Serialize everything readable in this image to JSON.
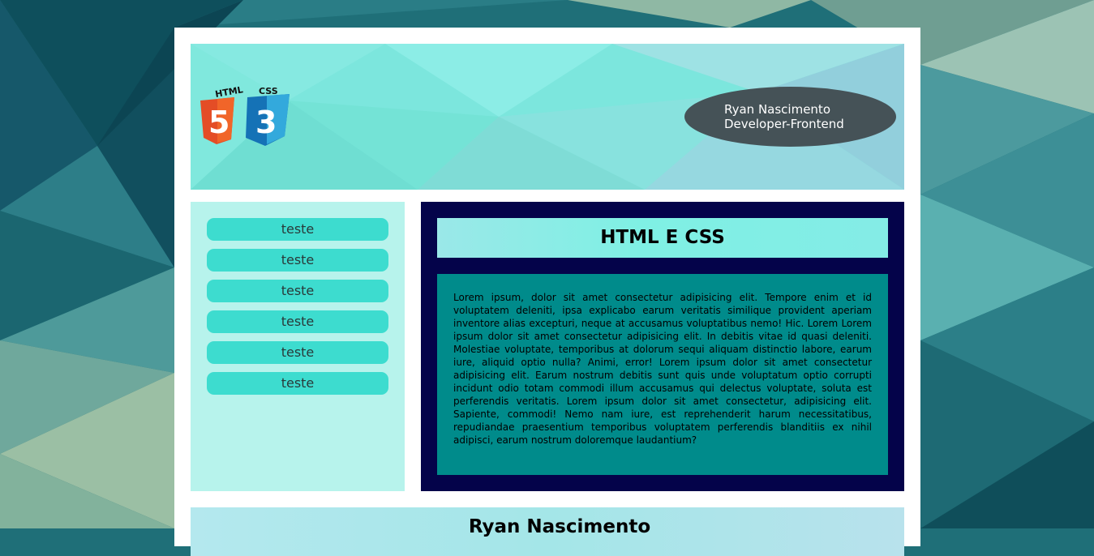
{
  "header": {
    "logo_html_text": "HTML",
    "logo_css_text": "CSS",
    "logo_html_digit": "5",
    "logo_css_digit": "3",
    "author_name": "Ryan Nascimento",
    "author_role": "Developer-Frontend"
  },
  "sidebar": {
    "items": [
      {
        "label": "teste"
      },
      {
        "label": "teste"
      },
      {
        "label": "teste"
      },
      {
        "label": "teste"
      },
      {
        "label": "teste"
      },
      {
        "label": "teste"
      }
    ]
  },
  "main": {
    "title": "HTML E CSS",
    "body": "Lorem ipsum, dolor sit amet consectetur adipisicing elit. Tempore enim et id voluptatem deleniti, ipsa explicabo earum veritatis similique provident aperiam inventore alias excepturi, neque at accusamus voluptatibus nemo! Hic. Lorem Lorem ipsum dolor sit amet consectetur adipisicing elit. In debitis vitae id quasi deleniti. Molestiae voluptate, temporibus at dolorum sequi aliquam distinctio labore, earum iure, aliquid optio nulla? Animi, error! Lorem ipsum dolor sit amet consectetur adipisicing elit. Earum nostrum debitis sunt quis unde voluptatum optio corrupti incidunt odio totam commodi illum accusamus qui delectus voluptate, soluta est perferendis veritatis. Lorem ipsum dolor sit amet consectetur, adipisicing elit. Sapiente, commodi! Nemo nam iure, est reprehenderit harum necessitatibus, repudiandae praesentium temporibus voluptatem perferendis blanditiis ex nihil adipisci, earum nostrum doloremque laudantium?"
  },
  "footer": {
    "title": "Ryan Nascimento"
  },
  "colors": {
    "page_background": "#1f6f78",
    "container": "#ffffff",
    "header_accent": "#7fe3dc",
    "author_pill": "#455257",
    "sidebar_bg": "#b7f3ec",
    "sidebar_button": "#3ddccf",
    "main_bg": "#04034a",
    "main_body_bg": "#008b8b",
    "html5_orange": "#e44d26",
    "css3_blue": "#1572b6"
  }
}
